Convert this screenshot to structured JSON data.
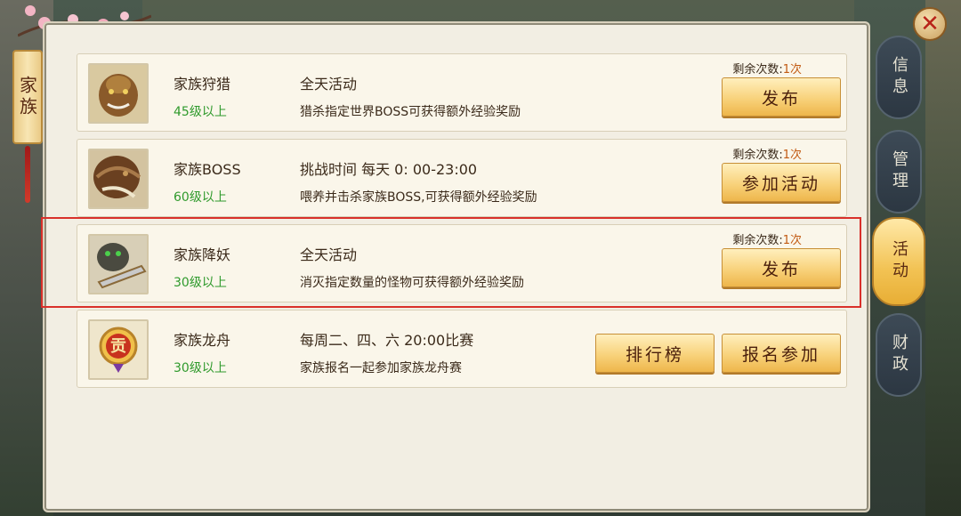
{
  "family_tab": {
    "label": "家族"
  },
  "close_button": {
    "symbol": "✕"
  },
  "side_tabs": [
    {
      "label": "信息",
      "active": false
    },
    {
      "label": "管理",
      "active": false
    },
    {
      "label": "活动",
      "active": true
    },
    {
      "label": "财政",
      "active": false
    }
  ],
  "activities": [
    {
      "name": "家族狩猎",
      "level": "45级以上",
      "time": "全天活动",
      "desc": "猎杀指定世界BOSS可获得额外经验奖励",
      "remain_label": "剩余次数:",
      "remain_count": "1次",
      "buttons": [
        "发布"
      ],
      "icon": "monster-portrait-icon"
    },
    {
      "name": "家族BOSS",
      "level": "60级以上",
      "time": "挑战时间 每天 0: 00-23:00",
      "desc": "喂养并击杀家族BOSS,可获得额外经验奖励",
      "remain_label": "剩余次数:",
      "remain_count": "1次",
      "buttons": [
        "参加活动"
      ],
      "icon": "boss-portrait-icon"
    },
    {
      "name": "家族降妖",
      "level": "30级以上",
      "time": "全天活动",
      "desc": "消灭指定数量的怪物可获得额外经验奖励",
      "remain_label": "剩余次数:",
      "remain_count": "1次",
      "buttons": [
        "发布"
      ],
      "icon": "demon-portrait-icon"
    },
    {
      "name": "家族龙舟",
      "level": "30级以上",
      "time": "每周二、四、六 20:00比赛",
      "desc": "家族报名一起参加家族龙舟赛",
      "remain_label": "",
      "remain_count": "",
      "buttons": [
        "排行榜",
        "报名参加"
      ],
      "icon": "contribution-badge-icon",
      "badge_text": "贡"
    }
  ],
  "colors": {
    "panel": "#f2eee3",
    "row": "#faf6ea",
    "level_text": "#2f9a2c",
    "remain_count": "#c25a12",
    "button_gold": "#f8d27b",
    "active_tab": "#f2c253",
    "highlight_border": "#d9302a"
  }
}
